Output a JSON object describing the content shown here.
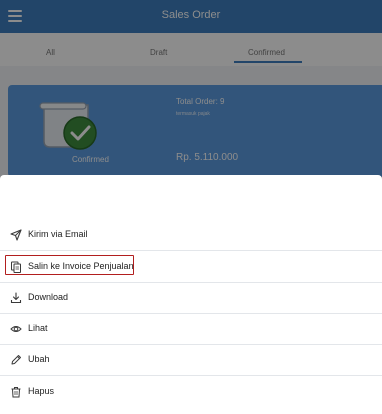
{
  "app": {
    "title": "Sales Order",
    "tabs": [
      "All",
      "Draft",
      "Confirmed"
    ],
    "card": {
      "status_label": "Confirmed",
      "total_order": "Total Order: 9",
      "sub": "termasuk pajak",
      "amount": "Rp. 5.110.000"
    }
  },
  "sheet": {
    "items": [
      {
        "label": "Kirim via Email",
        "icon": "send-icon"
      },
      {
        "label": "Salin ke Invoice Penjualan",
        "icon": "copy-icon"
      },
      {
        "label": "Download",
        "icon": "download-icon"
      },
      {
        "label": "Lihat",
        "icon": "eye-icon"
      },
      {
        "label": "Ubah",
        "icon": "pencil-icon"
      },
      {
        "label": "Hapus",
        "icon": "trash-icon"
      }
    ]
  },
  "colors": {
    "primary": "#3f7fc0",
    "card": "#5b9be0",
    "highlight": "#b21e1e"
  }
}
